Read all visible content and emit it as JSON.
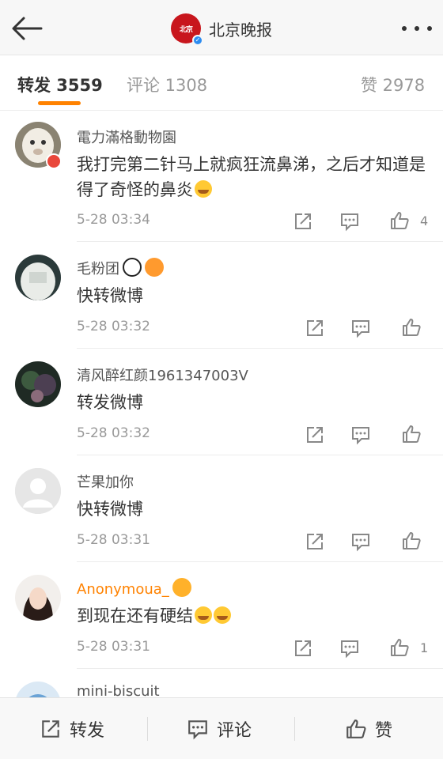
{
  "header": {
    "logo_text": "北京晚报",
    "title": "北京晚报"
  },
  "tabs": {
    "repost": "转发 3559",
    "comment": "评论 1308",
    "like": "赞 2978"
  },
  "comments": [
    {
      "user": "電力滿格動物園",
      "text": "我打完第二针马上就疯狂流鼻涕，之后才知道是得了奇怪的鼻炎",
      "emoji": "crying-emoji",
      "time": "5-28 03:34",
      "likes": "4"
    },
    {
      "user": "毛粉团",
      "text": "快转微博",
      "time": "5-28 03:32",
      "likes": ""
    },
    {
      "user": "清风醉红颜1961347003V",
      "text": "转发微博",
      "time": "5-28 03:32",
      "likes": ""
    },
    {
      "user": "芒果加你",
      "text": "快转微博",
      "time": "5-28 03:31",
      "likes": ""
    },
    {
      "user": "Anonymoua_",
      "text": "到现在还有硬结",
      "emoji": "crying-emoji",
      "time": "5-28 03:31",
      "likes": "1"
    },
    {
      "user": "mini-biscuit",
      "text": "",
      "time": "",
      "likes": ""
    }
  ],
  "bottom": {
    "repost": "转发",
    "comment": "评论",
    "like": "赞"
  },
  "colors": {
    "accent": "#ff8200",
    "logo_red": "#c8161d",
    "verified_blue": "#2d8cf0"
  }
}
